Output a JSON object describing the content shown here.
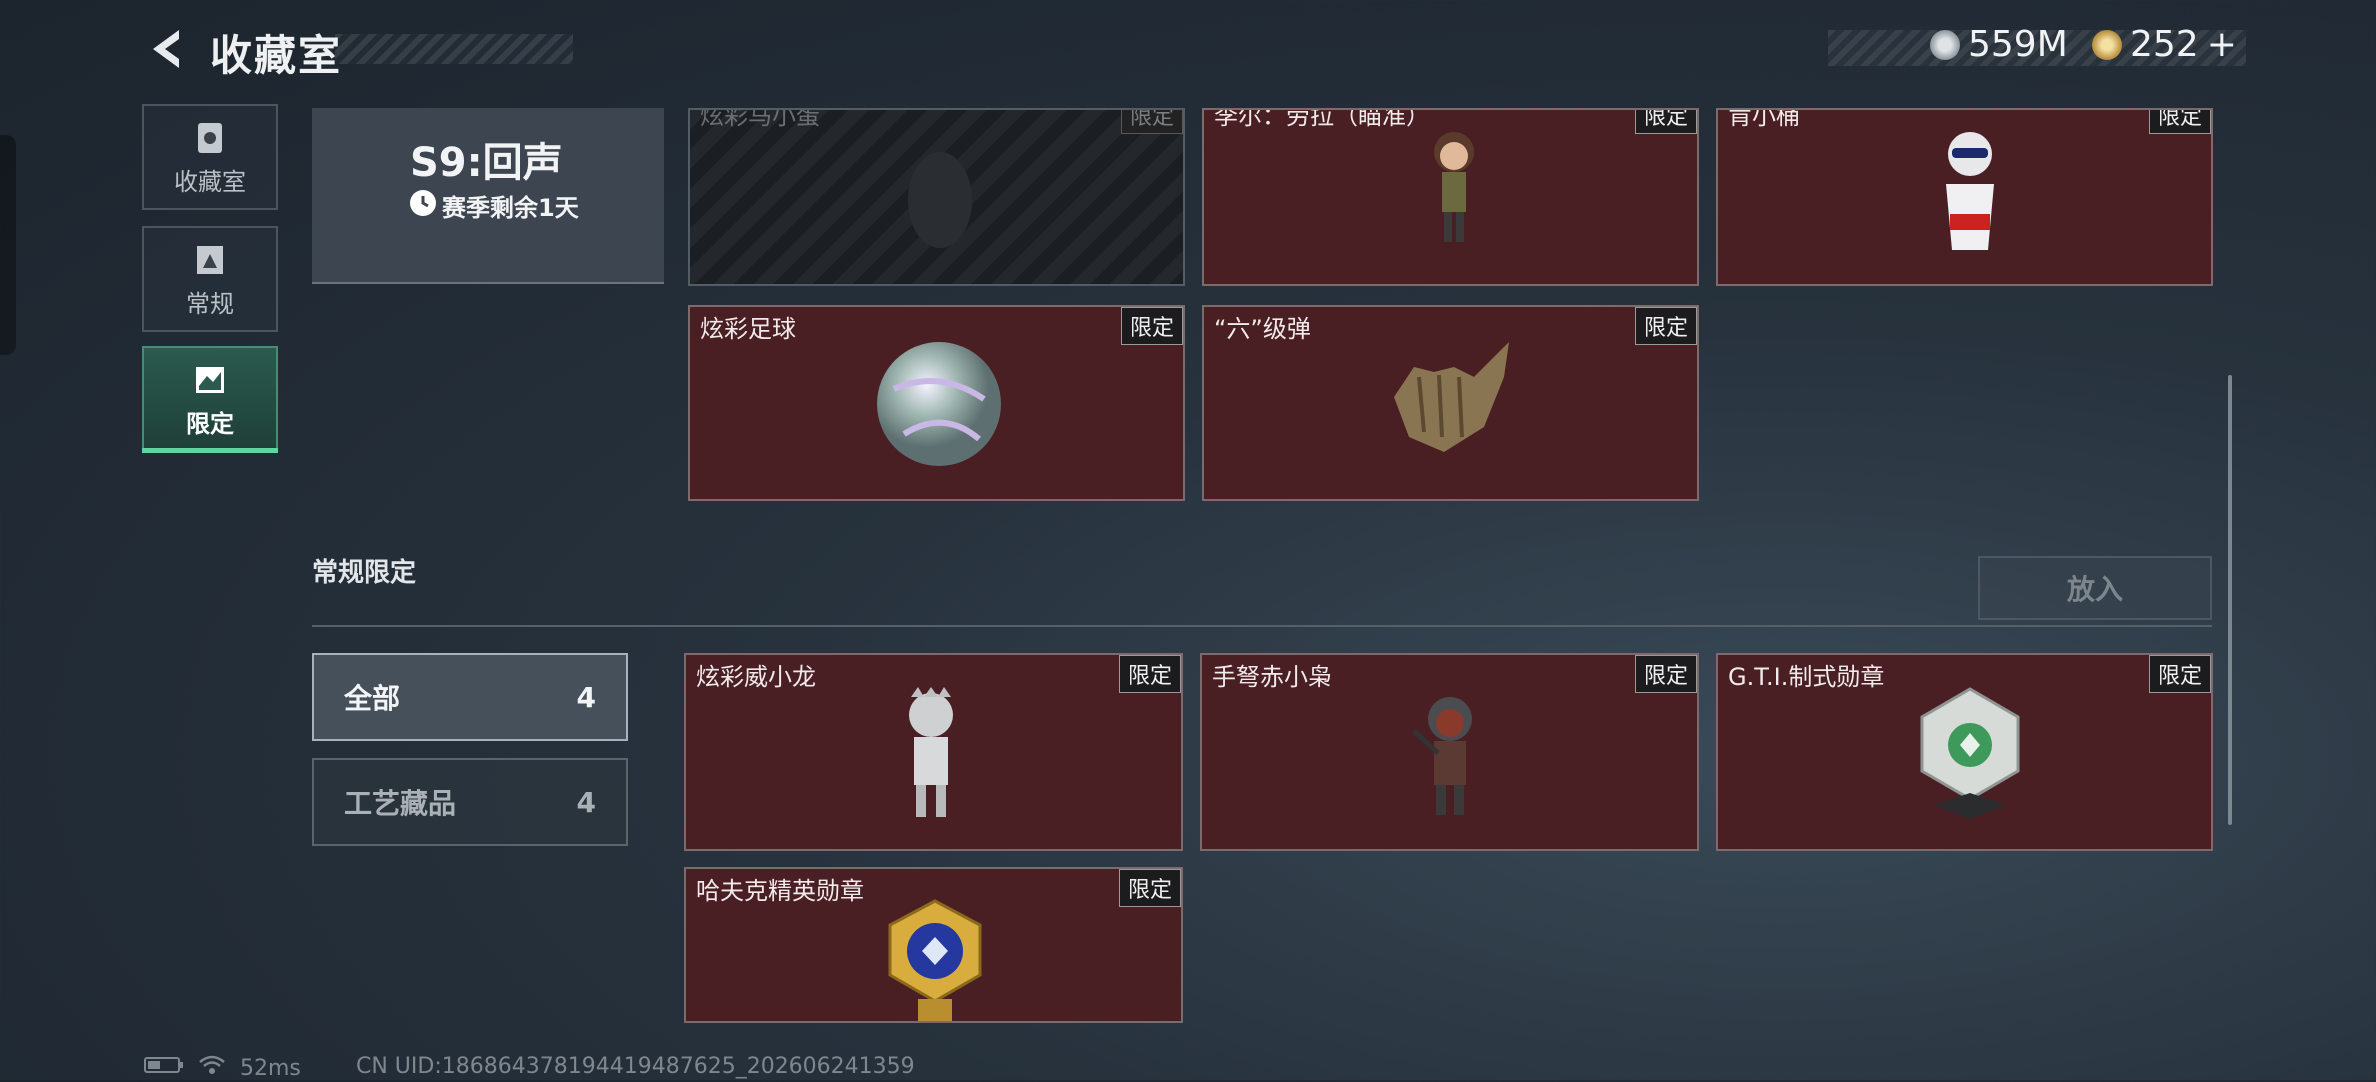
{
  "header": {
    "title": "收藏室",
    "currency": [
      {
        "icon": "silver-coin-icon",
        "value": "559M"
      },
      {
        "icon": "gold-coin-icon",
        "value": "252"
      }
    ],
    "add_symbol": "+"
  },
  "nav": [
    {
      "label": "收藏室",
      "icon": "collection-icon",
      "active": false
    },
    {
      "label": "常规",
      "icon": "regular-icon",
      "active": false
    },
    {
      "label": "限定",
      "icon": "limited-icon",
      "active": true
    }
  ],
  "season": {
    "title": "S9:回声",
    "remaining": "赛季剩余1天"
  },
  "season_items": [
    {
      "name": "炫彩马小蛋",
      "badge": "限定",
      "dim": true
    },
    {
      "name": "李尔：劳拉（瞄准）",
      "badge": "限定",
      "dim": false
    },
    {
      "name": "肯小桶",
      "badge": "限定",
      "dim": false
    },
    {
      "name": "炫彩足球",
      "badge": "限定",
      "dim": false
    },
    {
      "name": "“六”级弹",
      "badge": "限定",
      "dim": false
    }
  ],
  "section": {
    "title": "常规限定",
    "put_button": "放入"
  },
  "filters": [
    {
      "label": "全部",
      "count": "4",
      "active": true
    },
    {
      "label": "工艺藏品",
      "count": "4",
      "active": false
    }
  ],
  "regular_items": [
    {
      "name": "炫彩威小龙",
      "badge": "限定"
    },
    {
      "name": "手弩赤小枭",
      "badge": "限定"
    },
    {
      "name": "G.T.I.制式勋章",
      "badge": "限定"
    },
    {
      "name": "哈夫克精英勋章",
      "badge": "限定"
    }
  ],
  "status": {
    "ping": "52ms",
    "uid": "CN UID:186864378194419487625_202606241359"
  }
}
